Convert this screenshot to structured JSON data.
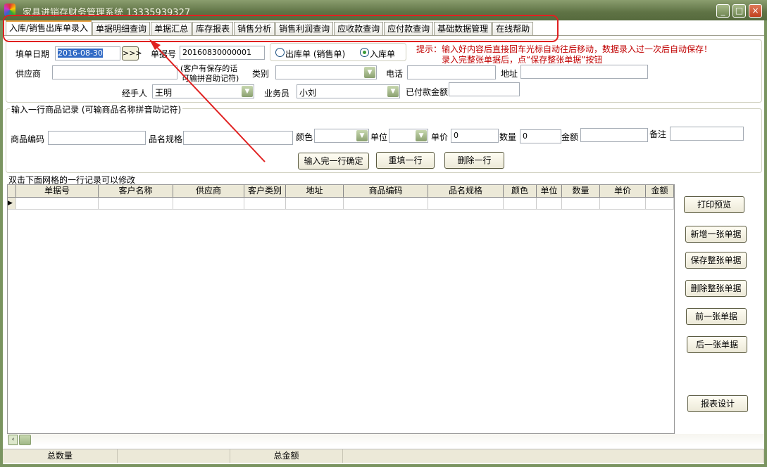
{
  "window": {
    "title": "家具进销存财务管理系统 13335939327",
    "minimize": "_",
    "maximize": "□",
    "close": "×"
  },
  "tabs": [
    "入库/销售出库单录入",
    "单据明细查询",
    "单据汇总",
    "库存报表",
    "销售分析",
    "销售利润查询",
    "应收款查询",
    "应付款查询",
    "基础数据管理",
    "在线帮助"
  ],
  "header": {
    "date_label": "填单日期",
    "date_value": "2016-08-30",
    "date_btn": ">>>",
    "bill_no_label": "单据号",
    "bill_no_value": "20160830000001",
    "radio_out": "出库单 (销售单)",
    "radio_in": "入库单",
    "supplier_label": "供应商",
    "supplier_hint_1": "(客户有保存的话",
    "supplier_hint_2": "可输拼音助记符)",
    "category_label": "类别",
    "phone_label": "电话",
    "address_label": "地址",
    "handler_label": "经手人",
    "handler_value": "王明",
    "salesman_label": "业务员",
    "salesman_value": "小刘",
    "paid_label": "已付款金额",
    "tip_1": "提示：输入好内容后直接回车光标自动往后移动，数据录入过一次后自动保存！",
    "tip_2": "录入完整张单据后，点“保存整张单据”按钮"
  },
  "line_entry": {
    "title": "输入一行商品记录 (可输商品名称拼音助记符)",
    "code_label": "商品编码",
    "spec_label": "品名规格",
    "color_label": "颜色",
    "unit_label": "单位",
    "price_label": "单价",
    "price_value": "0",
    "qty_label": "数量",
    "qty_value": "0",
    "amount_label": "金额",
    "remark_label": "备注",
    "confirm_btn": "输入完一行确定",
    "reset_btn": "重填一行",
    "delete_btn": "删除一行"
  },
  "grid": {
    "title": "双击下面网格的一行记录可以修改",
    "columns": [
      "单据号",
      "客户名称",
      "供应商",
      "客户类别",
      "地址",
      "商品编码",
      "品名规格",
      "颜色",
      "单位",
      "数量",
      "单价",
      "金额"
    ]
  },
  "side_buttons": [
    "打印预览",
    "新增一张单据",
    "保存整张单据",
    "删除整张单据",
    "前一张单据",
    "后一张单据",
    "报表设计"
  ],
  "status": {
    "total_qty": "总数量",
    "total_amount": "总金额"
  },
  "annotation_color": "#e02020"
}
